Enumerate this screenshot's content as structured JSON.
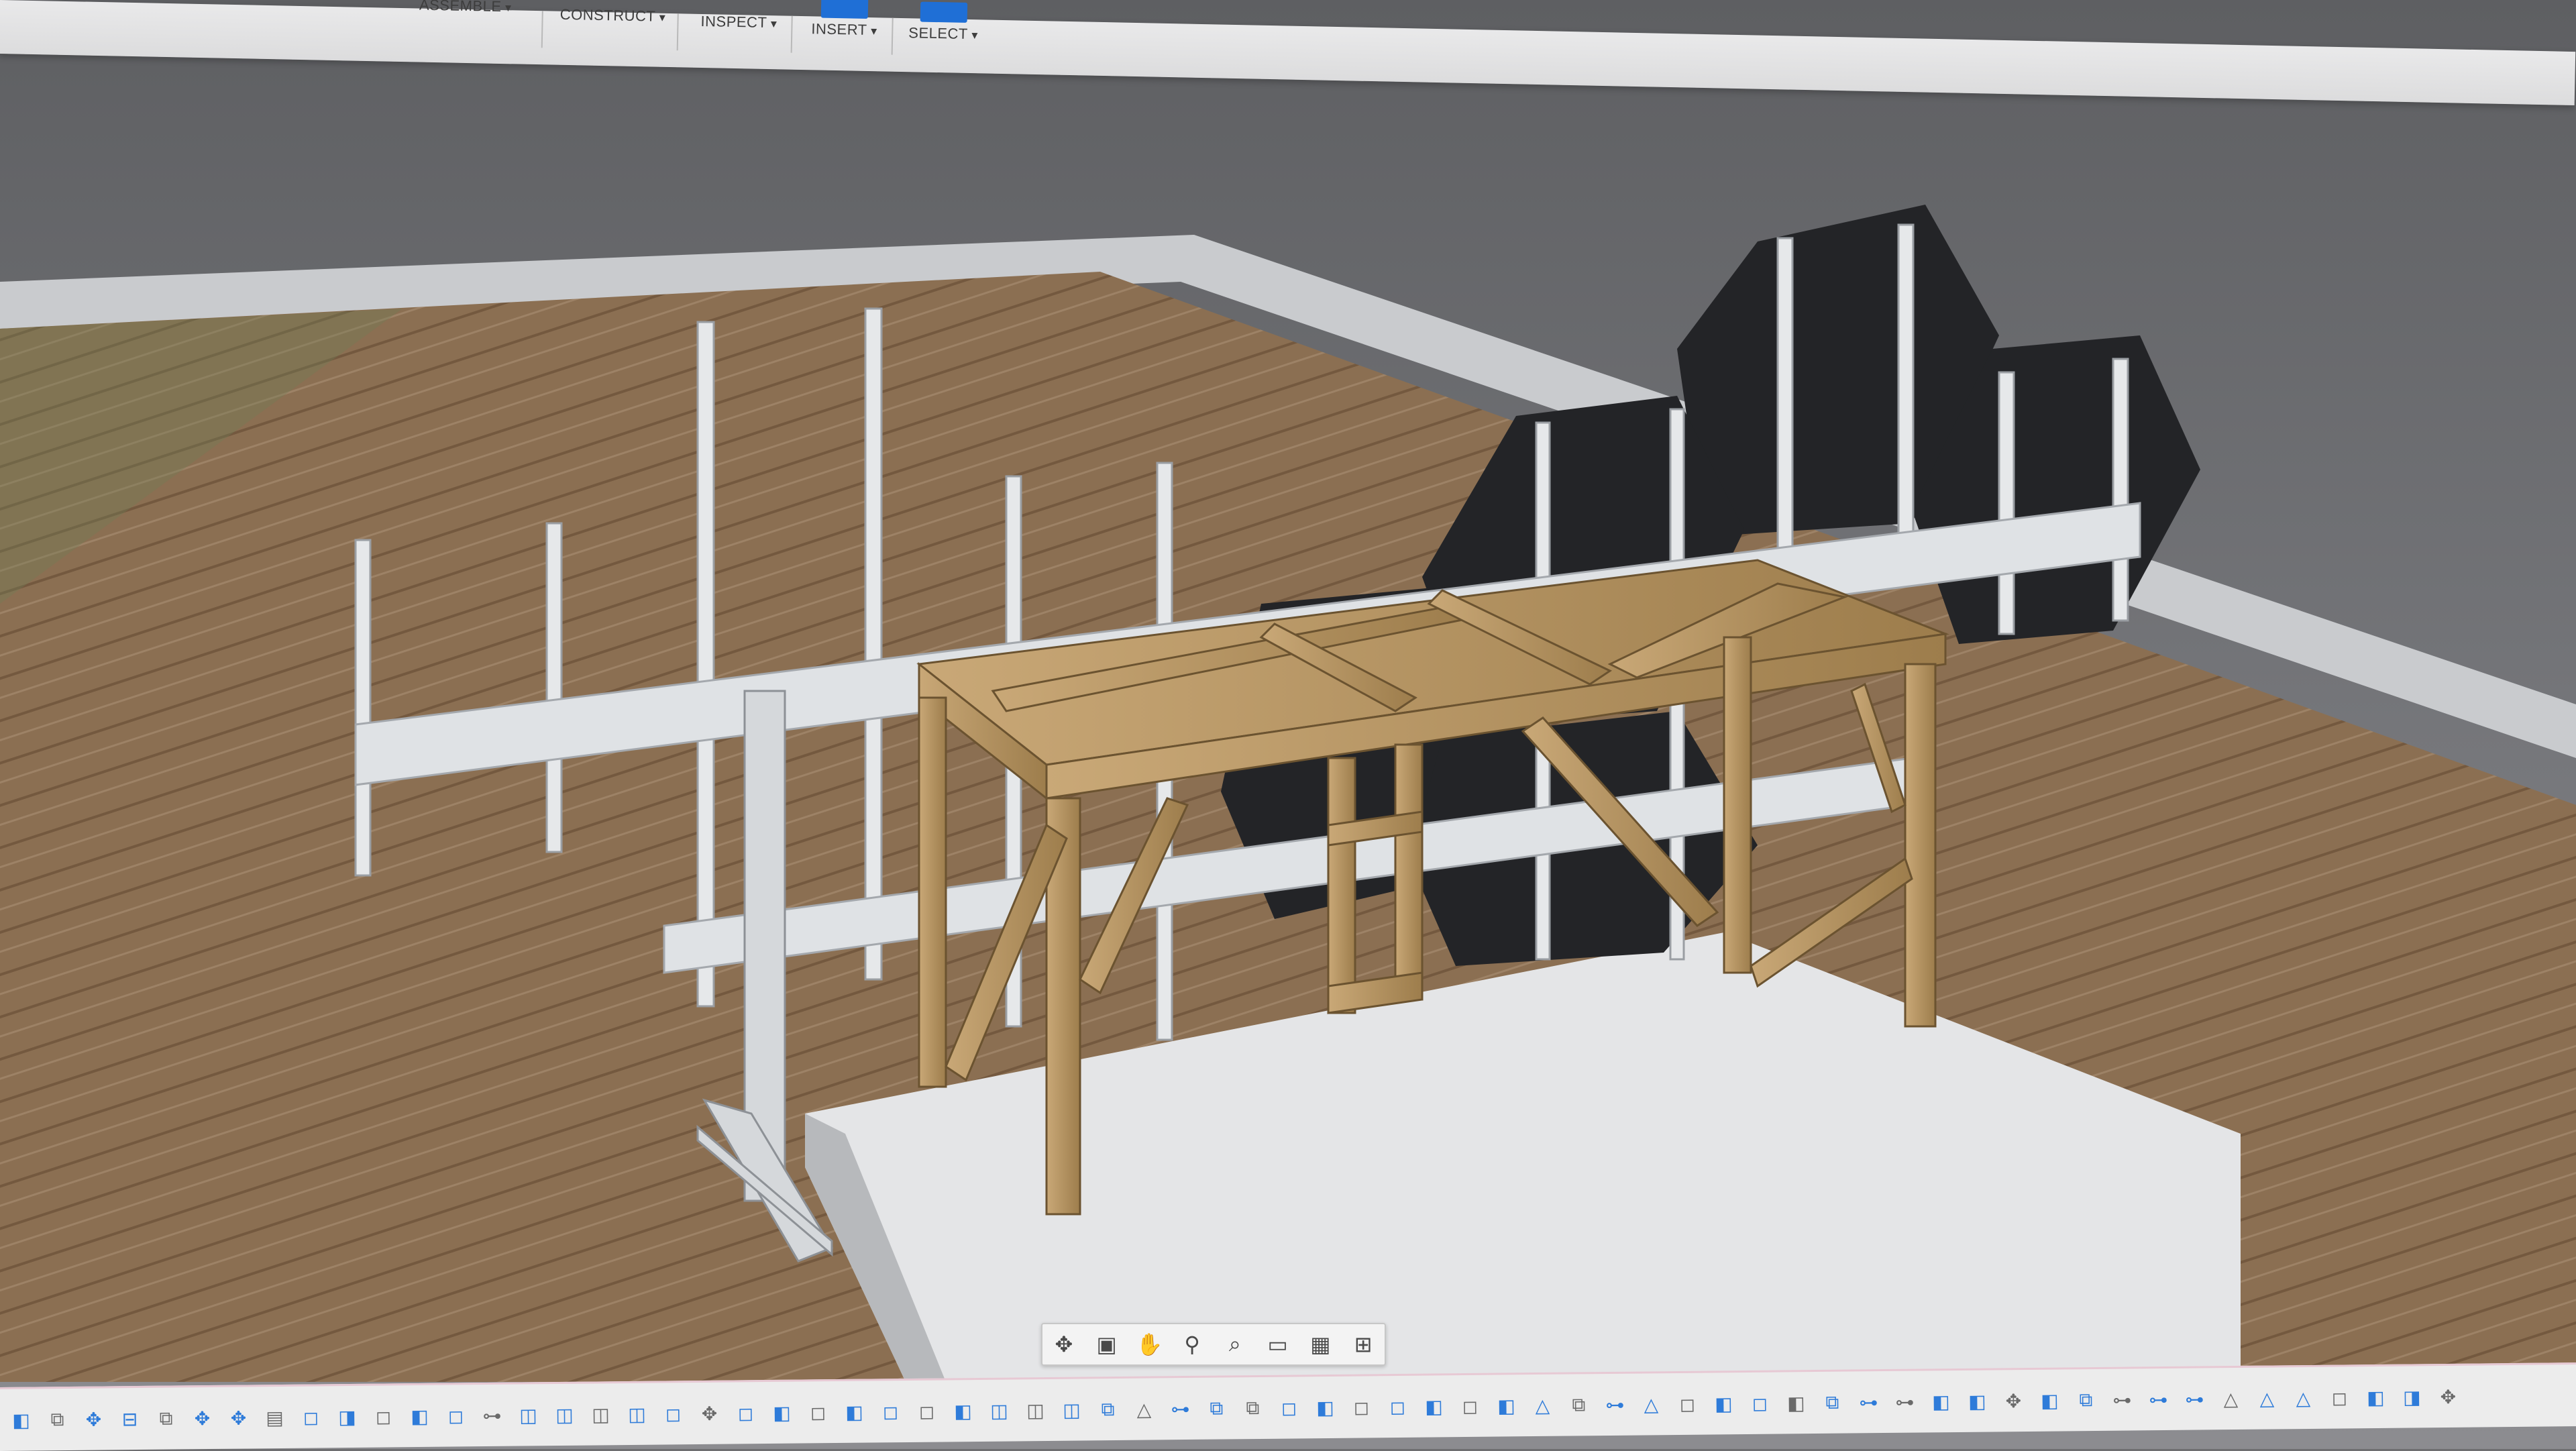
{
  "window": {
    "app": "Fusion 360 design workspace"
  },
  "toolbar": {
    "groups": [
      {
        "label": "ASSEMBLE"
      },
      {
        "label": "CONSTRUCT"
      },
      {
        "label": "INSPECT"
      },
      {
        "label": "INSERT"
      },
      {
        "label": "SELECT"
      }
    ]
  },
  "colors": {
    "wood": "#b8955d",
    "frame": "#d9dde1",
    "dark_panel": "#222326",
    "floor": "#8a6e4f",
    "sky": "#6e6e70",
    "accent": "#1f6fd6"
  },
  "navbar": {
    "items": [
      {
        "name": "orbit-icon",
        "glyph": "✥"
      },
      {
        "name": "look-at-icon",
        "glyph": "▣"
      },
      {
        "name": "pan-icon",
        "glyph": "✋"
      },
      {
        "name": "zoom-icon",
        "glyph": "⚲"
      },
      {
        "name": "fit-icon",
        "glyph": "⌕"
      },
      {
        "name": "display-settings-icon",
        "glyph": "▭"
      },
      {
        "name": "grid-icon",
        "glyph": "▦"
      },
      {
        "name": "viewports-icon",
        "glyph": "⊞"
      }
    ]
  },
  "timeline": {
    "items": [
      "◧",
      "⧉",
      "✥",
      "⊟",
      "⧉",
      "✥",
      "✥",
      "▤",
      "◻",
      "◨",
      "◻",
      "◧",
      "◻",
      "⊶",
      "◫",
      "◫",
      "◫",
      "◫",
      "◻",
      "✥",
      "◻",
      "◧",
      "◻",
      "◧",
      "◻",
      "◻",
      "◧",
      "◫",
      "◫",
      "◫",
      "⧉",
      "△",
      "⊶",
      "⧉",
      "⧉",
      "◻",
      "◧",
      "◻",
      "◻",
      "◧",
      "◻",
      "◧",
      "△",
      "⧉",
      "⊶",
      "△",
      "◻",
      "◧",
      "◻",
      "◧",
      "⧉",
      "⊶",
      "⊶",
      "◧",
      "◧",
      "✥",
      "◧",
      "⧉",
      "⊶",
      "⊶",
      "⊶",
      "△",
      "△",
      "△",
      "◻",
      "◧",
      "◨",
      "✥"
    ]
  }
}
